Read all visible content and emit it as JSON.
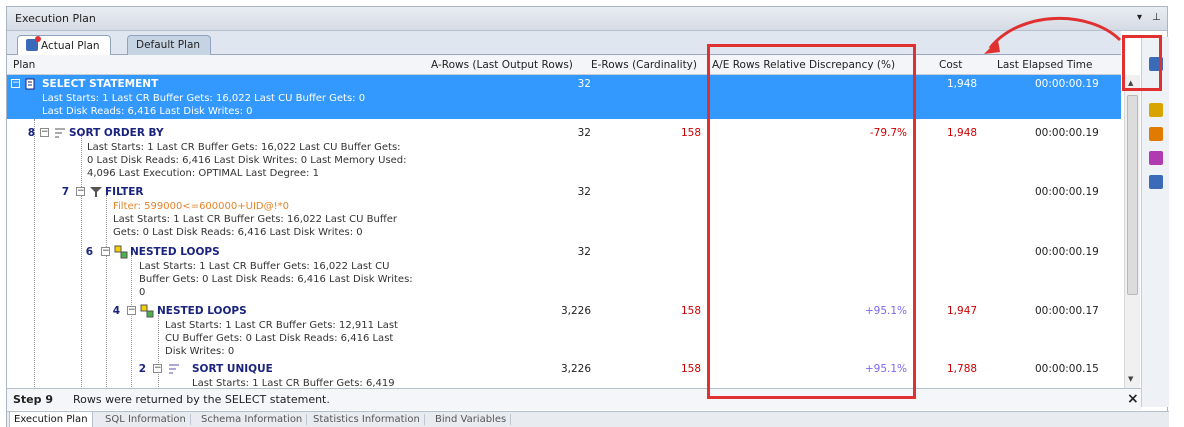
{
  "window": {
    "title": "Execution Plan",
    "pin_glyph": "▾ ⊥"
  },
  "tabs": [
    {
      "label": "Actual Plan",
      "active": true,
      "icon": "actual-plan-icon"
    },
    {
      "label": "Default Plan",
      "active": false
    }
  ],
  "columns": {
    "plan": "Plan",
    "a_rows": "A-Rows (Last Output Rows)",
    "e_rows": "E-Rows (Cardinality)",
    "discrepancy": "A/E Rows Relative Discrepancy (%)",
    "cost": "Cost",
    "elapsed": "Last Elapsed Time"
  },
  "rows": [
    {
      "step": "",
      "name": "SELECT STATEMENT",
      "icon": "select-statement-icon",
      "details": [
        "Last Starts: 1  Last CR Buffer Gets: 16,022  Last CU Buffer Gets: 0",
        "Last Disk Reads: 6,416  Last Disk Writes: 0"
      ],
      "a_rows": "32",
      "e_rows": "",
      "discrepancy": "",
      "cost": "1,948",
      "elapsed": "00:00:00.19",
      "selected": true
    },
    {
      "step": "8",
      "name": "SORT ORDER BY",
      "icon": "sort-icon",
      "details": [
        "Last Starts: 1  Last CR Buffer Gets: 16,022  Last CU Buffer Gets:",
        "0  Last Disk Reads: 6,416  Last Disk Writes: 0  Last Memory Used:",
        "4,096  Last Execution: OPTIMAL  Last Degree: 1"
      ],
      "a_rows": "32",
      "e_rows": "158",
      "discrepancy": "-79.7%",
      "cost": "1,948",
      "elapsed": "00:00:00.19"
    },
    {
      "step": "7",
      "name": "FILTER",
      "icon": "filter-icon",
      "filter": "Filter: 599000<=600000+UID@!*0",
      "details": [
        "Last Starts: 1  Last CR Buffer Gets: 16,022  Last CU Buffer",
        "Gets: 0  Last Disk Reads: 6,416  Last Disk Writes: 0"
      ],
      "a_rows": "32",
      "e_rows": "",
      "discrepancy": "",
      "cost": "",
      "elapsed": "00:00:00.19"
    },
    {
      "step": "6",
      "name": "NESTED LOOPS",
      "icon": "nested-loops-icon",
      "details": [
        "Last Starts: 1  Last CR Buffer Gets: 16,022  Last CU",
        "Buffer Gets: 0  Last Disk Reads: 6,416  Last Disk Writes:",
        "0"
      ],
      "a_rows": "32",
      "e_rows": "",
      "discrepancy": "",
      "cost": "",
      "elapsed": "00:00:00.19"
    },
    {
      "step": "4",
      "name": "NESTED LOOPS",
      "icon": "nested-loops-icon",
      "details": [
        "Last Starts: 1  Last CR Buffer Gets: 12,911  Last",
        "CU Buffer Gets: 0  Last Disk Reads: 6,416  Last",
        "Disk Writes: 0"
      ],
      "a_rows": "3,226",
      "e_rows": "158",
      "discrepancy": "+95.1%",
      "cost": "1,947",
      "elapsed": "00:00:00.17"
    },
    {
      "step": "2",
      "name": "SORT UNIQUE",
      "icon": "sort-unique-icon",
      "details": [
        "Last Starts: 1  Last CR Buffer Gets: 6,419"
      ],
      "a_rows": "3,226",
      "e_rows": "158",
      "discrepancy": "+95.1%",
      "cost": "1,788",
      "elapsed": "00:00:00.15"
    }
  ],
  "status": {
    "step": "Step 9",
    "message": "Rows were returned by the SELECT statement.",
    "close_glyph": "×"
  },
  "bottom_tabs": [
    "Execution Plan",
    "SQL Information",
    "Schema Information",
    "Statistics Information",
    "Bind Variables"
  ],
  "colors": {
    "selected_row": "#3399ff",
    "highlight_box": "#e03030",
    "discrepancy_text": "#7b68ee",
    "estimate_text": "#cc0000"
  }
}
